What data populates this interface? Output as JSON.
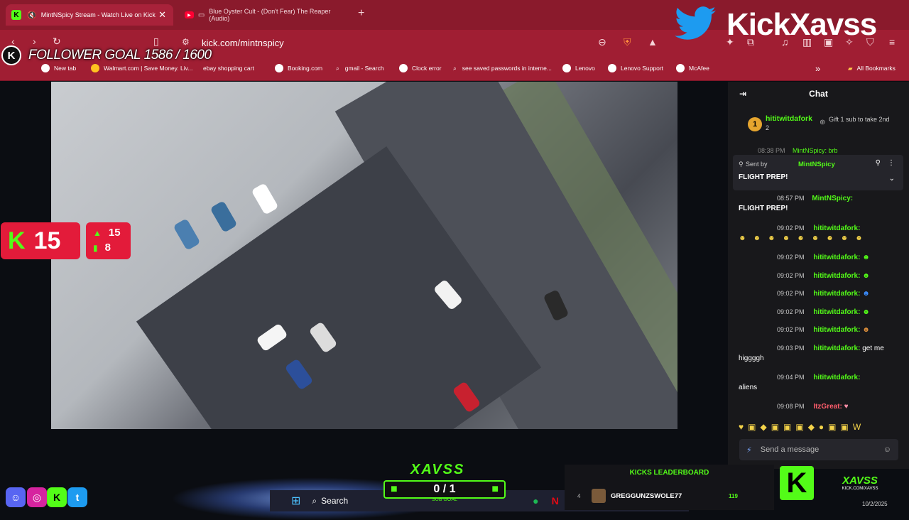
{
  "tabs": [
    {
      "label": "MintNSpicy Stream - Watch Live on Kick"
    },
    {
      "label": "Blue Oyster Cult - (Don't Fear) The Reaper (Audio)"
    }
  ],
  "url": "kick.com/mintnspicy",
  "bookmarks": [
    "New tab",
    "Walmart.com | Save Money. Liv...",
    "ebay shopping cart",
    "Booking.com",
    "gmail - Search",
    "Clock error",
    "see saved passwords in interne...",
    "Lenovo",
    "Lenovo Support",
    "McAfee"
  ],
  "all_bookmarks": "All Bookmarks",
  "overlay": {
    "follower_goal": "FOLLOWER GOAL 1586 / 1600",
    "viewers": "15",
    "stat_up": "15",
    "stat_chart": "8",
    "brand_name": "KickXavss",
    "sub_goal_title": "XAVSS",
    "sub_goal_value": "0 / 1",
    "sub_goal_label": "SUB GOAL",
    "leaderboard_title": "KICKS LEADERBOARD",
    "leader_rank": "4",
    "leader_name": "GREGGUNZSWOLE77",
    "leader_score": "119",
    "logo_text": "XAVSS",
    "logo_sub": "KICK.COM/XAVSS"
  },
  "chat": {
    "title": "Chat",
    "top_gifter": "hititwitdafork",
    "top_gifter_count": "2",
    "gift_prompt": "Gift 1 sub to take 2nd",
    "pinned_sent_by": "Sent by",
    "pinned_user": "MintNSpicy",
    "pinned_text": "FLIGHT PREP!",
    "ghost_time": "08:38 PM",
    "ghost_user": "MintNSpicy: brb",
    "messages": [
      {
        "time": "08:57 PM",
        "user": "MintNSpicy:",
        "text": "FLIGHT PREP!"
      },
      {
        "time": "09:02 PM",
        "user": "hititwitdafork:",
        "text": ""
      },
      {
        "time": "09:02 PM",
        "user": "hititwitdafork:",
        "text": ""
      },
      {
        "time": "09:02 PM",
        "user": "hititwitdafork:",
        "text": ""
      },
      {
        "time": "09:02 PM",
        "user": "hititwitdafork:",
        "text": ""
      },
      {
        "time": "09:02 PM",
        "user": "hititwitdafork:",
        "text": ""
      },
      {
        "time": "09:02 PM",
        "user": "hititwitdafork:",
        "text": ""
      },
      {
        "time": "09:03 PM",
        "user": "hititwitdafork:",
        "text": "get me higgggh"
      },
      {
        "time": "09:04 PM",
        "user": "hititwitdafork:",
        "text": "aliens"
      },
      {
        "time": "09:08 PM",
        "user": "ItzGreat:",
        "text": ""
      }
    ],
    "input_placeholder": "Send a message"
  },
  "taskbar": {
    "search": "Search",
    "date": "10/2/2025"
  },
  "colors": {
    "kick_green": "#53fc18",
    "overlay_red": "#e31b3a",
    "browser_red": "#a01e33"
  }
}
